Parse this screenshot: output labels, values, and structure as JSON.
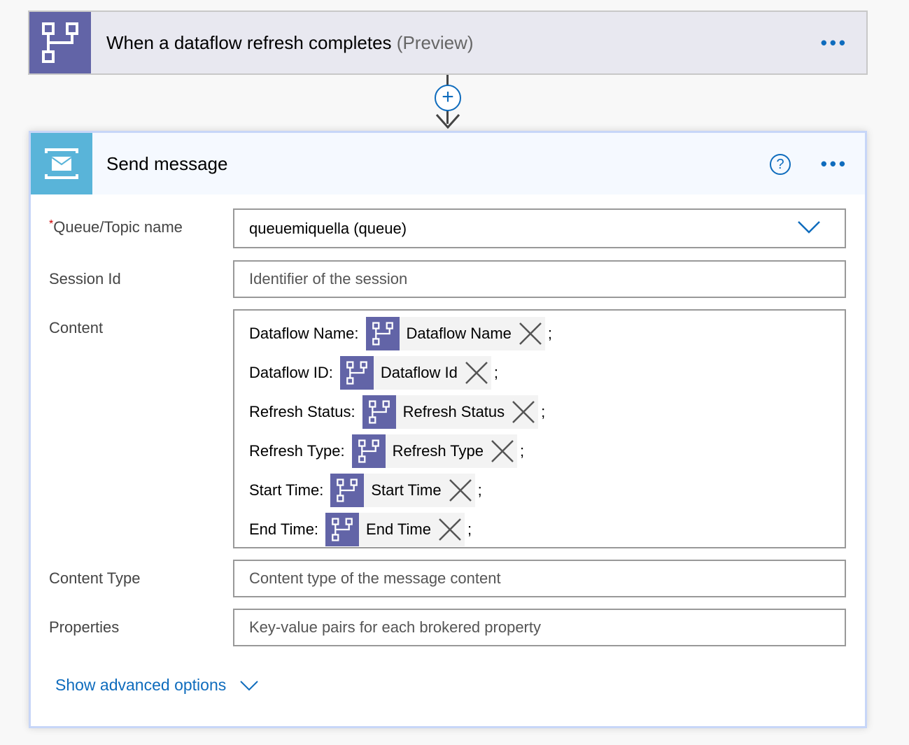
{
  "trigger": {
    "title": "When a dataflow refresh completes",
    "badge": "(Preview)",
    "icon": "dataflow-icon",
    "color": "#6264a7"
  },
  "action": {
    "title": "Send message",
    "icon": "service-bus-message-icon",
    "color": "#59b4d9",
    "fields": {
      "queue": {
        "label": "Queue/Topic name",
        "required": "*",
        "value": "queuemiquella (queue)"
      },
      "session": {
        "label": "Session Id",
        "placeholder": "Identifier of the session"
      },
      "content": {
        "label": "Content",
        "rows": [
          {
            "label": "Dataflow Name:",
            "token": "Dataflow Name"
          },
          {
            "label": "Dataflow ID:",
            "token": "Dataflow Id"
          },
          {
            "label": "Refresh Status:",
            "token": "Refresh Status"
          },
          {
            "label": "Refresh Type:",
            "token": "Refresh Type"
          },
          {
            "label": "Start Time:",
            "token": "Start Time"
          },
          {
            "label": "End Time:",
            "token": "End Time"
          }
        ],
        "separator": ";"
      },
      "content_type": {
        "label": "Content Type",
        "placeholder": "Content type of the message content"
      },
      "properties": {
        "label": "Properties",
        "placeholder": "Key-value pairs for each brokered property"
      }
    },
    "advanced": "Show advanced options"
  },
  "more": "..."
}
